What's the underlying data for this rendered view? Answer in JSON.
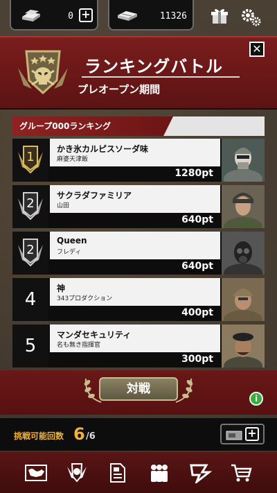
{
  "resources": {
    "gold_value": "0",
    "cash_value": "11326"
  },
  "header": {
    "title": "ランキングバトル",
    "subtitle": "プレオープン期間"
  },
  "group": {
    "label": "グループ000ランキング"
  },
  "ranking": [
    {
      "rank": "1",
      "team": "かき氷カルピスソーダ味",
      "leader": "麻婆天津飯",
      "points": "1280pt"
    },
    {
      "rank": "2",
      "team": "サクラダファミリア",
      "leader": "山田",
      "points": "640pt"
    },
    {
      "rank": "2",
      "team": "Queen",
      "leader": "フレディ",
      "points": "640pt"
    },
    {
      "rank": "4",
      "team": "神",
      "leader": "343プロダクション",
      "points": "400pt"
    },
    {
      "rank": "5",
      "team": "マンダセキュリティ",
      "leader": "名も無き指揮官",
      "points": "300pt"
    }
  ],
  "battle": {
    "button_label": "対戦",
    "info_label": "i"
  },
  "challenge": {
    "label": "挑戦可能回数",
    "current": "6",
    "max": "/6"
  },
  "colors": {
    "header_red": "#7a1d1d",
    "accent_gold": "#f2b233",
    "info_green": "#3daa3d"
  },
  "nav_icons": [
    "map-icon",
    "rank-emblem-icon",
    "document-icon",
    "squad-icon",
    "formation-icon",
    "shop-cart-icon"
  ]
}
